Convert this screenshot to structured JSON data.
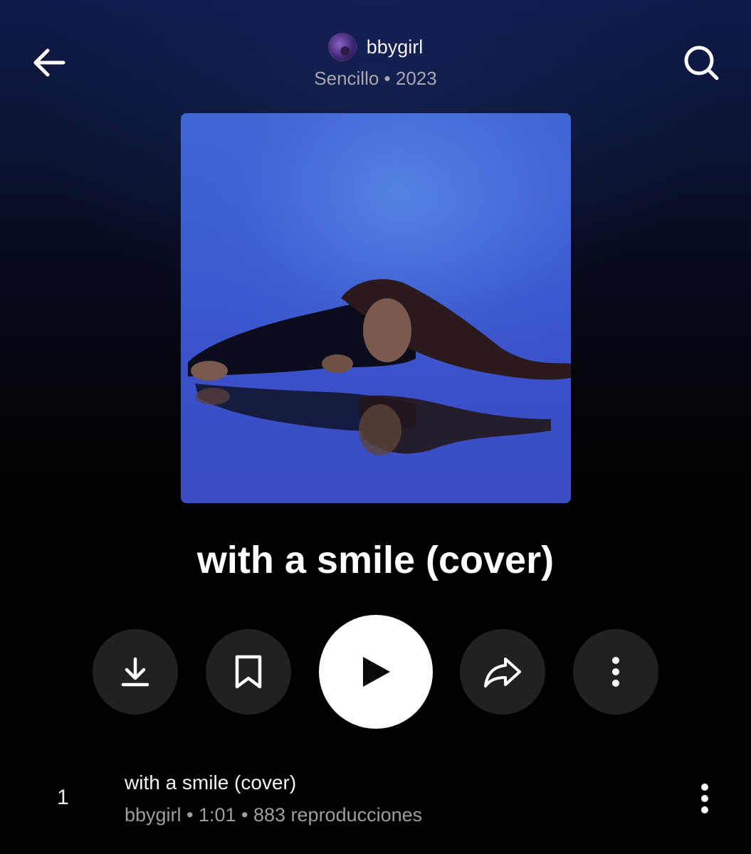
{
  "header": {
    "back_icon": "arrow-left-icon",
    "search_icon": "search-icon",
    "artist_name": "bbygirl",
    "subtitle": "Sencillo • 2023"
  },
  "album": {
    "title": "with a smile (cover)"
  },
  "actions": [
    {
      "name": "download",
      "icon": "download-icon"
    },
    {
      "name": "save",
      "icon": "bookmark-icon"
    },
    {
      "name": "play",
      "icon": "play-icon"
    },
    {
      "name": "share",
      "icon": "share-icon"
    },
    {
      "name": "more",
      "icon": "more-vertical-icon"
    }
  ],
  "tracks": [
    {
      "number": "1",
      "title": "with a smile (cover)",
      "meta": "bbygirl • 1:01 • 883 reproducciones"
    }
  ],
  "colors": {
    "background_top": "#111a4a",
    "background_bottom": "#000000",
    "button_dark": "#212121",
    "play_button": "#ffffff",
    "artwork_blue": "#3b5ad0",
    "secondary_text": "#a7a7ad"
  }
}
